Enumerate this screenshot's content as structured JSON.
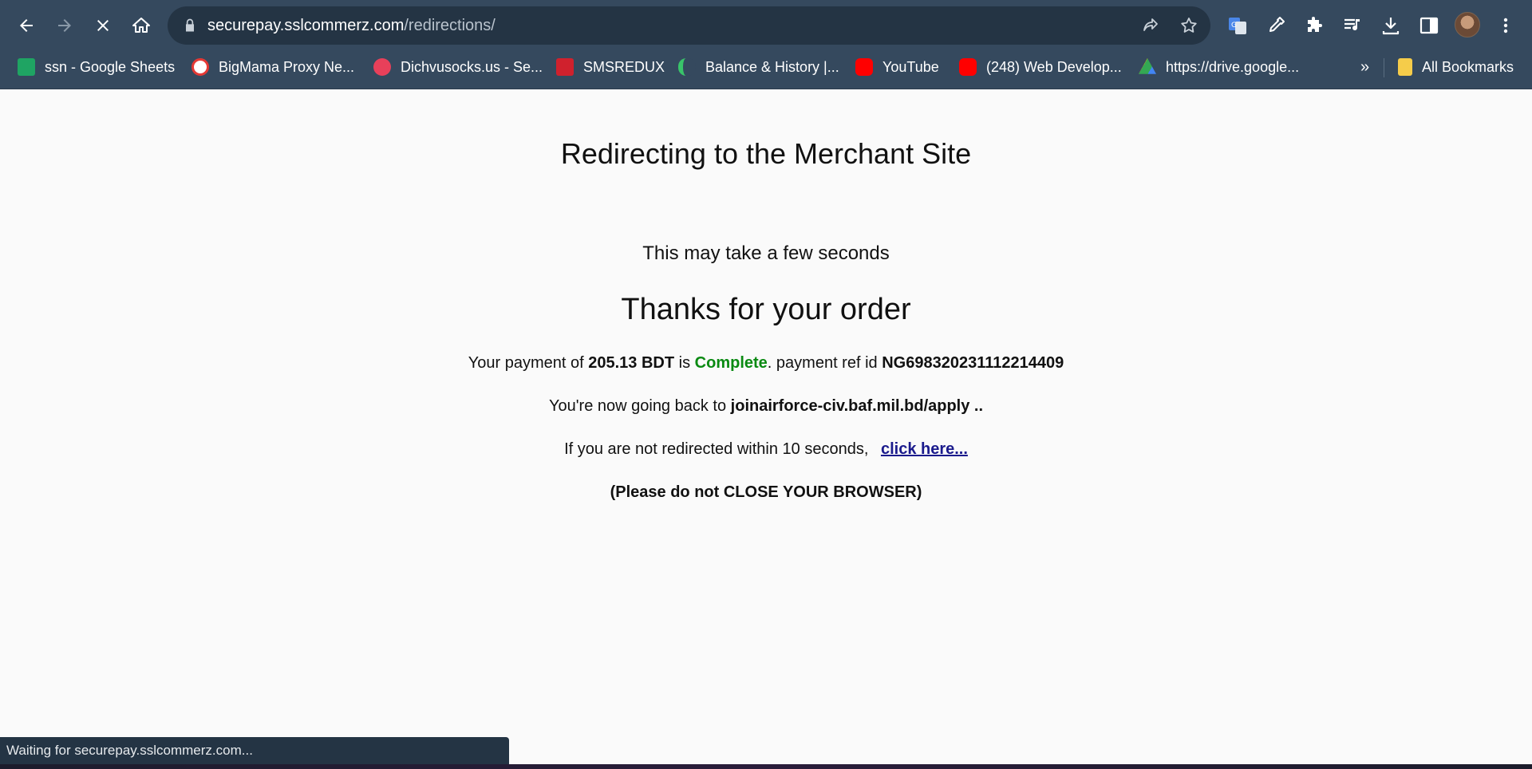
{
  "browser": {
    "url_host": "securepay.sslcommerz.com",
    "url_path": "/redirections/",
    "colors": {
      "chrome": "#35495e",
      "omnibox": "#243444"
    }
  },
  "bookmarks": [
    {
      "label": "ssn - Google Sheets",
      "icon": "google-sheets-icon"
    },
    {
      "label": "BigMama Proxy Ne...",
      "icon": "bigmama-icon"
    },
    {
      "label": "Dichvusocks.us - Se...",
      "icon": "dichvusocks-icon"
    },
    {
      "label": "SMSREDUX",
      "icon": "smsredux-icon"
    },
    {
      "label": "Balance & History |...",
      "icon": "balance-icon"
    },
    {
      "label": "YouTube",
      "icon": "youtube-icon"
    },
    {
      "label": "(248) Web Develop...",
      "icon": "youtube-icon"
    },
    {
      "label": "https://drive.google...",
      "icon": "google-drive-icon"
    }
  ],
  "bookmarks_overflow": "»",
  "all_bookmarks": "All Bookmarks",
  "page": {
    "title": "Redirecting to the Merchant Site",
    "subtitle": "This may take a few seconds",
    "thanks": "Thanks for your order",
    "payment_prefix": "Your payment of",
    "amount": "205.13 BDT",
    "is_word": "is",
    "status_word": "Complete",
    "status_color": "#0a8a12",
    "ref_prefix": ". payment ref id",
    "ref_id": "NG698320231112214409",
    "back_prefix": "You're now going back to",
    "back_target": "joinairforce-civ.baf.mil.bd/apply ..",
    "redirect_text": "If you are not redirected within 10 seconds,",
    "click_here": "click here...",
    "warning": "(Please do not CLOSE YOUR BROWSER)"
  },
  "status_bar": "Waiting for securepay.sslcommerz.com..."
}
